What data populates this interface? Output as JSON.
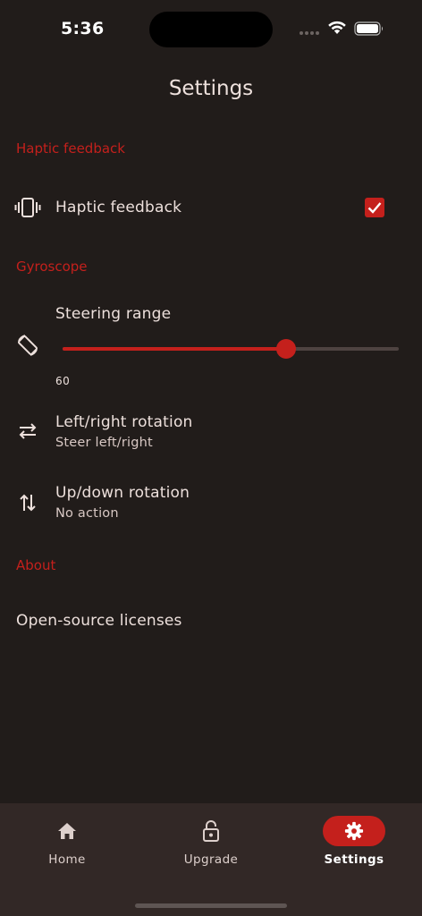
{
  "status_bar": {
    "time": "5:36"
  },
  "header": {
    "title": "Settings"
  },
  "sections": {
    "haptic": {
      "header": "Haptic feedback",
      "item_label": "Haptic feedback",
      "checked": true,
      "icon": "vibration-icon"
    },
    "gyroscope": {
      "header": "Gyroscope",
      "steering": {
        "label": "Steering range",
        "value_text": "60",
        "fraction": 0.665,
        "icon": "screen-rotation-icon"
      },
      "left_right": {
        "title": "Left/right rotation",
        "subtitle": "Steer left/right",
        "icon": "swap-horizontal-icon"
      },
      "up_down": {
        "title": "Up/down rotation",
        "subtitle": "No action",
        "icon": "swap-vertical-icon"
      }
    },
    "about": {
      "header": "About",
      "licenses_label": "Open-source licenses"
    }
  },
  "bottom_nav": {
    "items": [
      {
        "label": "Home",
        "icon": "home-icon",
        "active": false
      },
      {
        "label": "Upgrade",
        "icon": "lock-open-icon",
        "active": false
      },
      {
        "label": "Settings",
        "icon": "gear-icon",
        "active": true
      }
    ]
  },
  "colors": {
    "accent": "#c4201c",
    "background": "#211c1a",
    "nav_background": "#322826"
  }
}
